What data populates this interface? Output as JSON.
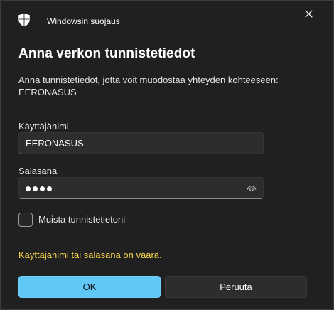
{
  "window": {
    "app_title": "Windowsin suojaus",
    "app_icon": "shield-icon",
    "close_icon": "close-icon"
  },
  "dialog": {
    "heading": "Anna verkon tunnistetiedot",
    "description_line1": "Anna tunnistetiedot, jotta voit muodostaa yhteyden kohteeseen:",
    "description_line2": "EERONASUS"
  },
  "form": {
    "username": {
      "label": "Käyttäjänimi",
      "value": "EERONASUS"
    },
    "password": {
      "label": "Salasana",
      "masked_length": 4,
      "reveal_icon": "eye-icon"
    },
    "remember": {
      "label": "Muista tunnistetietoni",
      "checked": false
    },
    "error": "Käyttäjänimi tai salasana on väärä."
  },
  "buttons": {
    "ok_label": "OK",
    "cancel_label": "Peruuta"
  },
  "colors": {
    "background": "#202020",
    "accent": "#5fc8f7",
    "error": "#f6d54a",
    "input_background": "#2d2d2d"
  }
}
